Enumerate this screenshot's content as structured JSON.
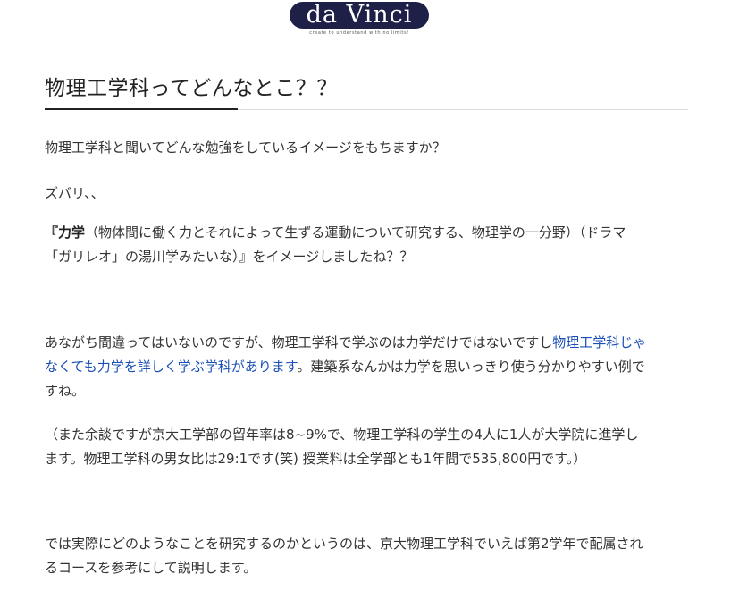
{
  "header": {
    "logo_text": "da Vinci",
    "tagline": "create to understand with no limits!"
  },
  "article": {
    "title": "物理工学科ってどんなとこ？？",
    "p1": "物理工学科と聞いてどんな勉強をしているイメージをもちますか？",
    "p2": "ズバリ、、",
    "p3": {
      "open": "『",
      "bold": "力学",
      "line1_rest": "（物体間に働く力とそれによって生ずる運動について研究する、物理学の一分野）（ドラマ",
      "line2": "「ガリレオ」の湯川学みたいな）』をイメージしましたね？？"
    },
    "p4": {
      "line1_text": "あながち間違ってはいないのですが、物理工学科で学ぶのは力学だけではないですし",
      "line1_link": "物理工学科じゃ",
      "line2_link": "なくても力学を詳しく学ぶ学科があります",
      "line2_text": "。建築系なんかは力学を思いっきり使う分かりやすい例で",
      "line3": "すね。"
    },
    "p5": {
      "line1": "（また余談ですが京大工学部の留年率は8~9%で、物理工学科の学生の4人に1人が大学院に進学し",
      "line2": "ます。物理工学科の男女比は29:1です(笑) 授業料は全学部とも1年間で535,800円です。）"
    },
    "p6": {
      "line1": "では実際にどのようなことを研究するのかというのは、京大物理工学科でいえば第2学年で配属され",
      "line2": "るコースを参考にして説明します。"
    }
  },
  "colors": {
    "logo_bg": "#1f2048",
    "link": "#1a4fb5",
    "text": "#333333"
  }
}
